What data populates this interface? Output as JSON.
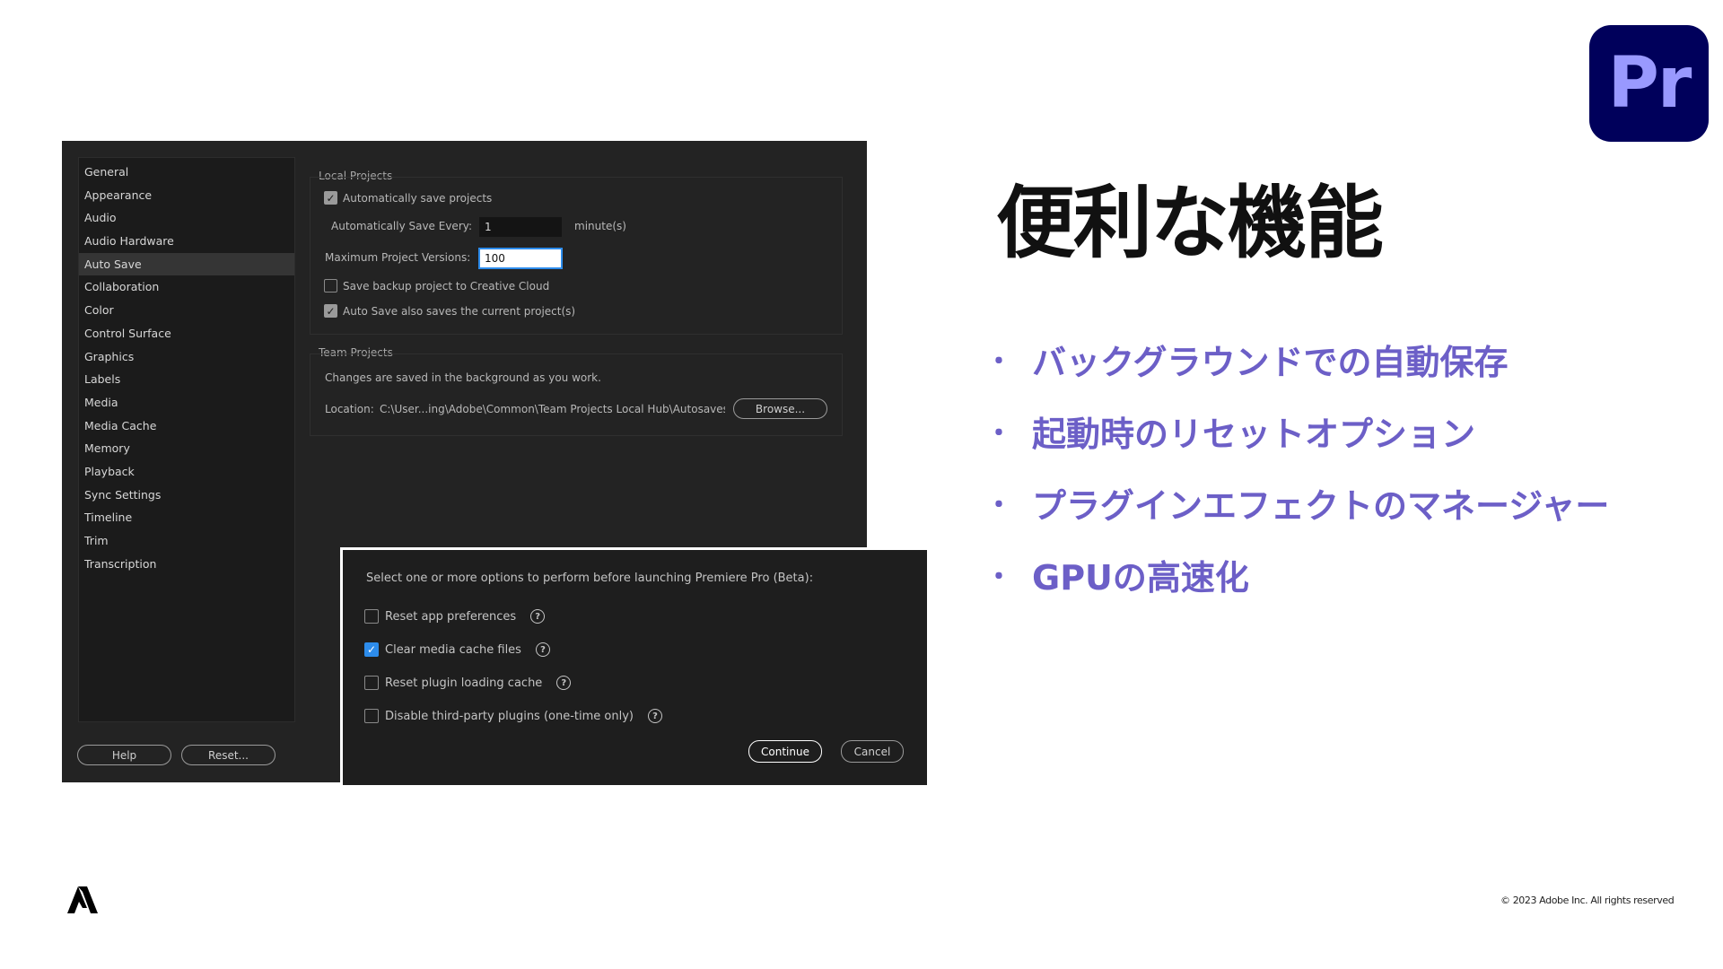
{
  "logo": {
    "text": "Pr"
  },
  "slide": {
    "title": "便利な機能",
    "bullets": [
      "バックグラウンドでの自動保存",
      "起動時のリセットオプション",
      "プラグインエフェクトのマネージャー",
      "GPUの高速化"
    ],
    "bullet_mark": "・",
    "accent_color": "#6c5fc7"
  },
  "prefs": {
    "sidebar": [
      "General",
      "Appearance",
      "Audio",
      "Audio Hardware",
      "Auto Save",
      "Collaboration",
      "Color",
      "Control Surface",
      "Graphics",
      "Labels",
      "Media",
      "Media Cache",
      "Memory",
      "Playback",
      "Sync Settings",
      "Timeline",
      "Trim",
      "Transcription"
    ],
    "selected_item": "Auto Save",
    "help_label": "Help",
    "reset_label": "Reset...",
    "local": {
      "title": "Local Projects",
      "auto_save_label": "Automatically save projects",
      "auto_save_checked": true,
      "every_label": "Automatically Save Every:",
      "every_value": "1",
      "every_unit": "minute(s)",
      "versions_label": "Maximum Project Versions:",
      "versions_value": "100",
      "cloud_label": "Save backup project to Creative Cloud",
      "cloud_checked": false,
      "current_label": "Auto Save also saves the current project(s)",
      "current_checked": true
    },
    "team": {
      "title": "Team Projects",
      "info": "Changes are saved in the background as you work.",
      "location_label": "Location:",
      "location_path": "C:\\User...ing\\Adobe\\Common\\Team Projects Local Hub\\Autosaves",
      "browse_label": "Browse..."
    }
  },
  "startup": {
    "prompt": "Select one or more options to perform before launching Premiere Pro (Beta):",
    "options": [
      {
        "label": "Reset app preferences",
        "checked": false
      },
      {
        "label": "Clear media cache files",
        "checked": true
      },
      {
        "label": "Reset plugin loading cache",
        "checked": false
      },
      {
        "label": "Disable third-party plugins (one-time only)",
        "checked": false
      }
    ],
    "help_glyph": "?",
    "continue_label": "Continue",
    "cancel_label": "Cancel"
  },
  "footer": {
    "copyright": "© 2023 Adobe Inc. All rights reserved"
  }
}
